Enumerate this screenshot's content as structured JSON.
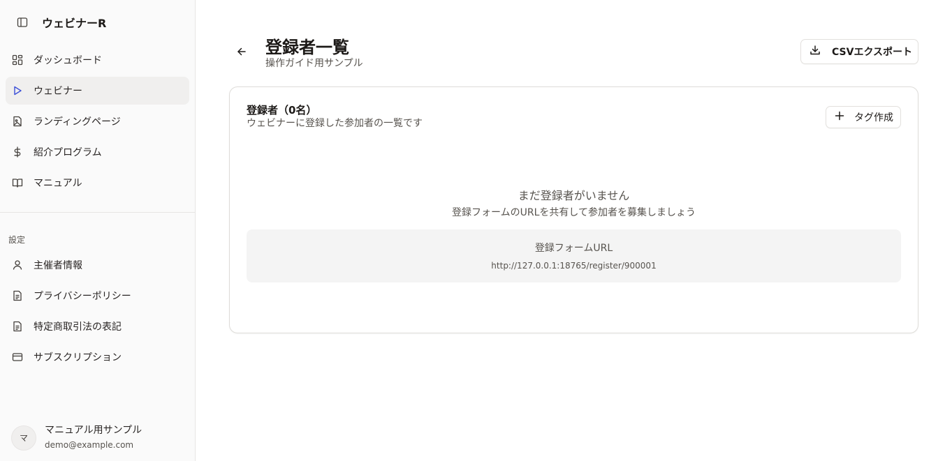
{
  "app": {
    "name": "ウェビナーR"
  },
  "sidebar": {
    "main_items": [
      {
        "label": "ダッシュボード",
        "icon": "dashboard-icon",
        "active": false
      },
      {
        "label": "ウェビナー",
        "icon": "play-icon",
        "active": true
      },
      {
        "label": "ランディングページ",
        "icon": "image-file-icon",
        "active": false
      },
      {
        "label": "紹介プログラム",
        "icon": "dollar-icon",
        "active": false
      },
      {
        "label": "マニュアル",
        "icon": "book-icon",
        "active": false
      }
    ],
    "settings_label": "設定",
    "settings_items": [
      {
        "label": "主催者情報",
        "icon": "user-icon"
      },
      {
        "label": "プライバシーポリシー",
        "icon": "document-icon"
      },
      {
        "label": "特定商取引法の表記",
        "icon": "document-icon"
      },
      {
        "label": "サブスクリプション",
        "icon": "credit-card-icon"
      }
    ],
    "user": {
      "avatar_initial": "マ",
      "name": "マニュアル用サンプル",
      "email": "demo@example.com"
    }
  },
  "header": {
    "title": "登録者一覧",
    "subtitle": "操作ガイド用サンプル",
    "export_label": "CSVエクスポート"
  },
  "card": {
    "title": "登録者（0名）",
    "subtitle": "ウェビナーに登録した参加者の一覧です",
    "tag_button_label": "タグ作成",
    "empty_title": "まだ登録者がいません",
    "empty_subtitle": "登録フォームのURLを共有して参加者を募集しましょう",
    "url_label": "登録フォームURL",
    "url_value": "http://127.0.0.1:18765/register/900001"
  },
  "colors": {
    "active_icon": "#3b4fd8",
    "active_bg": "#f0efee",
    "text_muted": "#57534e"
  }
}
